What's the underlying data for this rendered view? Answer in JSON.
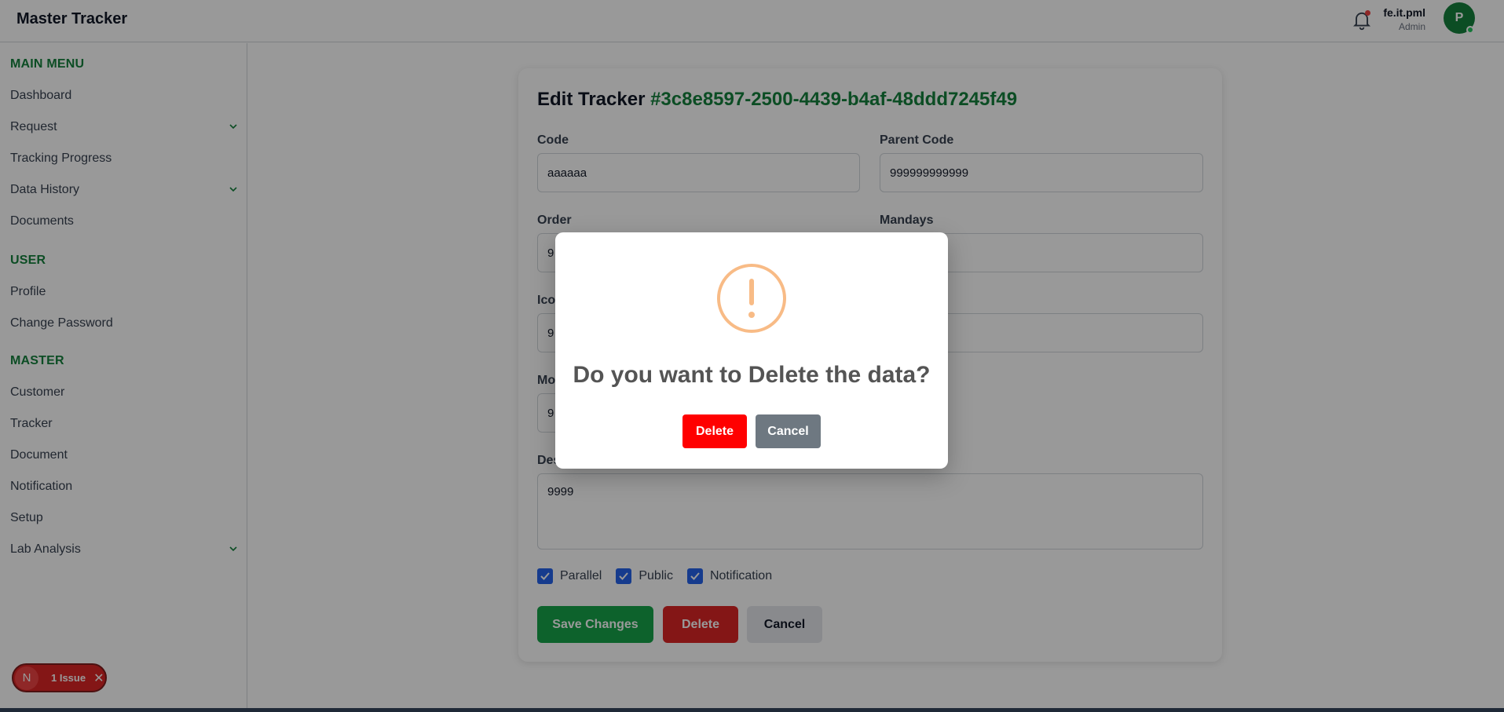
{
  "app": {
    "title": "Master Tracker"
  },
  "user": {
    "name": "fe.it.pml",
    "role": "Admin",
    "initial": "P"
  },
  "sidebar": {
    "sections": [
      {
        "title": "MAIN MENU",
        "items": [
          {
            "label": "Dashboard",
            "expandable": false
          },
          {
            "label": "Request",
            "expandable": true
          },
          {
            "label": "Tracking Progress",
            "expandable": false
          },
          {
            "label": "Data History",
            "expandable": true
          },
          {
            "label": "Documents",
            "expandable": false
          }
        ]
      },
      {
        "title": "USER",
        "items": [
          {
            "label": "Profile",
            "expandable": false
          },
          {
            "label": "Change Password",
            "expandable": false
          }
        ]
      },
      {
        "title": "MASTER",
        "items": [
          {
            "label": "Customer",
            "expandable": false
          },
          {
            "label": "Tracker",
            "expandable": false
          },
          {
            "label": "Document",
            "expandable": false
          },
          {
            "label": "Notification",
            "expandable": false
          },
          {
            "label": "Setup",
            "expandable": false
          },
          {
            "label": "Lab Analysis",
            "expandable": true
          }
        ]
      }
    ]
  },
  "issue_badge": {
    "icon_letter": "N",
    "text": "1 Issue"
  },
  "form": {
    "title": "Edit Tracker",
    "tracker_id": "#3c8e8597-2500-4439-b4af-48ddd7245f49",
    "fields": {
      "code": {
        "label": "Code",
        "value": "aaaaaa"
      },
      "parent_code": {
        "label": "Parent Code",
        "value": "999999999999"
      },
      "order": {
        "label": "Order",
        "value": "9"
      },
      "mandays": {
        "label": "Mandays",
        "value": ""
      },
      "icon": {
        "label": "Ico",
        "value": "9"
      },
      "mo": {
        "label": "Mo",
        "value": "9"
      },
      "description": {
        "label": "Des",
        "value": "9999"
      }
    },
    "checkboxes": [
      {
        "label": "Parallel",
        "checked": true
      },
      {
        "label": "Public",
        "checked": true
      },
      {
        "label": "Notification",
        "checked": true
      }
    ],
    "buttons": {
      "save": "Save Changes",
      "delete": "Delete",
      "cancel": "Cancel"
    }
  },
  "modal": {
    "icon": "warning-icon",
    "question": "Do you want to Delete the data?",
    "confirm": "Delete",
    "cancel": "Cancel",
    "colors": {
      "confirm": "#ff0000",
      "cancel": "#6e7881",
      "icon": "#f8bb86"
    }
  },
  "colors": {
    "accent": "#15803d",
    "danger": "#dc2626",
    "checkbox": "#2563eb"
  }
}
